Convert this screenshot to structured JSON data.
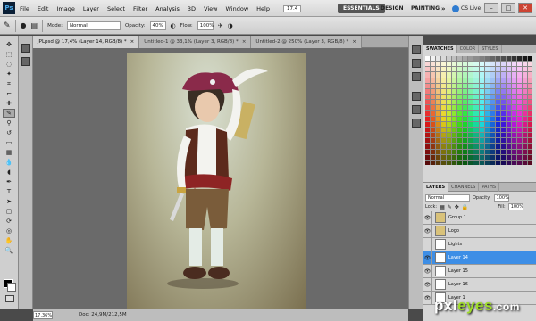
{
  "app": {
    "logo": "Ps"
  },
  "menu": [
    "File",
    "Edit",
    "Image",
    "Layer",
    "Select",
    "Filter",
    "Analysis",
    "3D",
    "View",
    "Window",
    "Help"
  ],
  "zoom_menu": "17.4",
  "workspaces": {
    "essentials": "ESSENTIALS",
    "design": "DESIGN",
    "painting": "PAINTING",
    "more": "»"
  },
  "cslive": "CS Live",
  "options": {
    "mode_label": "Mode:",
    "mode_value": "Normal",
    "opacity_label": "Opacity:",
    "opacity_value": "40%",
    "flow_label": "Flow:",
    "flow_value": "100%"
  },
  "tabs": [
    {
      "label": "JPLpsd @ 17,4% (Layer 14, RGB/8) *",
      "close": "×"
    },
    {
      "label": "Untitled-1 @ 33,1% (Layer 3, RGB/8) *",
      "close": "×"
    },
    {
      "label": "Untitled-2 @ 250% (Layer 3, RGB/8) *",
      "close": "×"
    }
  ],
  "swatches_tabs": [
    "SWATCHES",
    "COLOR",
    "STYLES"
  ],
  "layers_tabs": [
    "LAYERS",
    "CHANNELS",
    "PATHS"
  ],
  "layers_controls": {
    "blend": "Normal",
    "opacity_label": "Opacity:",
    "opacity_value": "100%",
    "lock_label": "Lock:",
    "fill_label": "Fill:",
    "fill_value": "100%"
  },
  "layers": [
    {
      "name": "Group 1",
      "visible": true,
      "selected": false
    },
    {
      "name": "Logo",
      "visible": true,
      "selected": false
    },
    {
      "name": "Lights",
      "visible": false,
      "selected": false
    },
    {
      "name": "Layer 14",
      "visible": true,
      "selected": true
    },
    {
      "name": "Layer 15",
      "visible": true,
      "selected": false
    },
    {
      "name": "Layer 16",
      "visible": true,
      "selected": false
    },
    {
      "name": "Layer 1",
      "visible": true,
      "selected": false
    }
  ],
  "status": {
    "zoom": "17,36%",
    "doc": "Doc: 24,9M/212,5M"
  },
  "watermark": {
    "a": "pxl",
    "b": "eyes",
    "c": ".com"
  },
  "colors": {
    "accent": "#3d8ee6",
    "selected_layer": "#3d8ee6"
  }
}
